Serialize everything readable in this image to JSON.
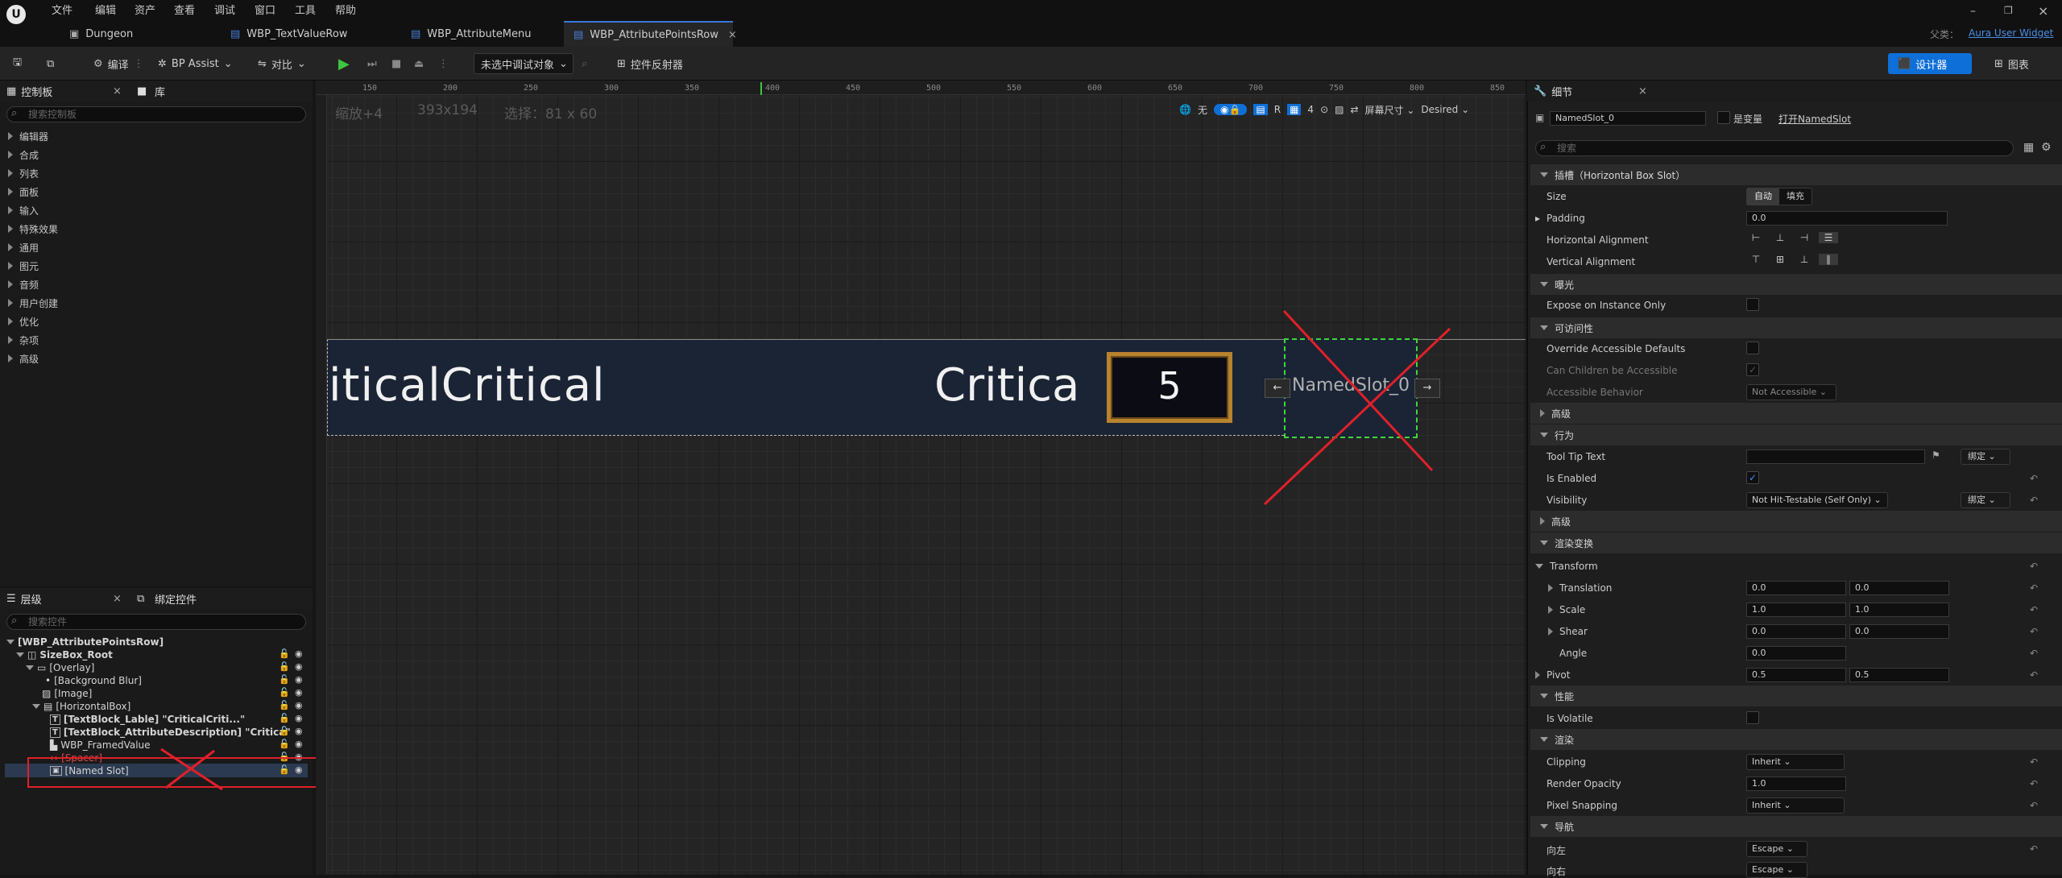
{
  "menu": [
    "文件",
    "编辑",
    "资产",
    "查看",
    "调试",
    "窗口",
    "工具",
    "帮助"
  ],
  "tabs": [
    "Dungeon",
    "WBP_TextValueRow",
    "WBP_AttributeMenu",
    "WBP_AttributePointsRow"
  ],
  "parent_label": "父类：",
  "parent_value": "Aura User Widget",
  "toolbar": {
    "compile": "编译",
    "bp_assist": "BP Assist",
    "diff": "对比",
    "debug_target": "未选中调试对象",
    "reflector": "控件反射器",
    "designer": "设计器",
    "graph": "图表"
  },
  "palette": {
    "tab1": "控制板",
    "tab2": "库",
    "search": "搜索控制板",
    "categories": [
      "编辑器",
      "合成",
      "列表",
      "面板",
      "输入",
      "特殊效果",
      "通用",
      "图元",
      "音频",
      "用户创建",
      "优化",
      "杂项",
      "高级"
    ]
  },
  "hierarchy": {
    "tab1": "层级",
    "tab2": "绑定控件",
    "search": "搜索控件",
    "items": [
      "[WBP_AttributePointsRow]",
      "SizeBox_Root",
      "[Overlay]",
      "[Background Blur]",
      "[Image]",
      "[HorizontalBox]",
      "[TextBlock_Lable] \"CriticalCriti...\"",
      "[TextBlock_AttributeDescription] \"Critica\"",
      "WBP_FramedValue",
      "[Spacer]",
      "[Named Slot]"
    ]
  },
  "canvas": {
    "zoom": "缩放+4",
    "size": "393x194",
    "selection": "选择：81 x 60",
    "none": "无",
    "grid_num": "4",
    "r_label": "R",
    "screen_size": "屏幕尺寸",
    "desired": "Desired",
    "ruler_h": [
      "150",
      "200",
      "250",
      "300",
      "350",
      "400",
      "450",
      "500",
      "550",
      "600",
      "650",
      "700",
      "750",
      "800",
      "850"
    ],
    "text_left": "iticalCritical",
    "text_mid": "Critica",
    "value": "5",
    "named_slot": "NamedSlot_0"
  },
  "details": {
    "tab": "细节",
    "name": "NamedSlot_0",
    "is_variable": "是变量",
    "open": "打开NamedSlot",
    "search": "搜索",
    "sec_slot": "插槽（Horizontal Box Slot）",
    "size": "Size",
    "auto": "自动",
    "fill": "填充",
    "padding": "Padding",
    "padding_val": "0.0",
    "h_align": "Horizontal Alignment",
    "v_align": "Vertical Alignment",
    "sec_expose": "曝光",
    "expose": "Expose on Instance Only",
    "sec_access": "可访问性",
    "override": "Override Accessible Defaults",
    "children": "Can Children be Accessible",
    "behavior": "Accessible Behavior",
    "behavior_val": "Not Accessible",
    "sec_adv": "高级",
    "sec_behavior": "行为",
    "tooltip": "Tool Tip Text",
    "bind": "绑定",
    "enabled": "Is Enabled",
    "visibility": "Visibility",
    "visibility_val": "Not Hit-Testable (Self Only)",
    "sec_adv2": "高级",
    "sec_render": "渲染变换",
    "transform": "Transform",
    "translation": "Translation",
    "t1": "0.0",
    "t2": "0.0",
    "scale": "Scale",
    "s1": "1.0",
    "s2": "1.0",
    "shear": "Shear",
    "sh1": "0.0",
    "sh2": "0.0",
    "angle": "Angle",
    "a1": "0.0",
    "pivot": "Pivot",
    "p1": "0.5",
    "p2": "0.5",
    "sec_perf": "性能",
    "volatile": "Is Volatile",
    "sec_rendering": "渲染",
    "clipping": "Clipping",
    "clipping_val": "Inherit",
    "opacity": "Render Opacity",
    "opacity_val": "1.0",
    "snapping": "Pixel Snapping",
    "snapping_val": "Inherit",
    "sec_nav": "导航",
    "left": "向左",
    "left_val": "Escape",
    "right": "向右",
    "right_val": "Escape"
  }
}
